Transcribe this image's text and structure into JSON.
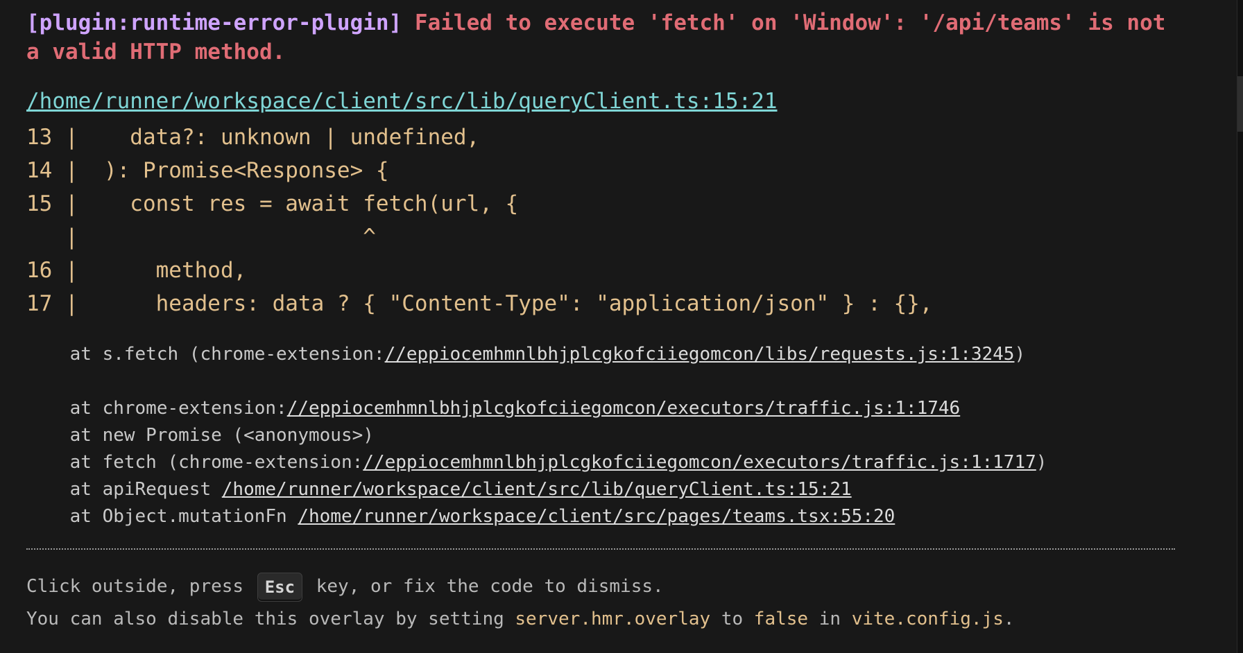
{
  "header": {
    "plugin": "[plugin:runtime-error-plugin]",
    "message": "Failed to execute 'fetch' on 'Window': '/api/teams' is not a valid HTTP method."
  },
  "file": "/home/runner/workspace/client/src/lib/queryClient.ts:15:21",
  "frame": [
    "13 |    data?: unknown | undefined,",
    "14 |  ): Promise<Response> {",
    "15 |    const res = await fetch(url, {",
    "   |                      ^",
    "16 |      method,",
    "17 |      headers: data ? { \"Content-Type\": \"application/json\" } : {},"
  ],
  "stack": {
    "l1_prefix": "    at s.fetch (chrome-extension:",
    "l1_link": "//eppiocemhmnlbhjplcgkofciiegomcon/libs/requests.js:1:3245",
    "l1_suffix": ")",
    "l2_prefix": "    at chrome-extension:",
    "l2_link": "//eppiocemhmnlbhjplcgkofciiegomcon/executors/traffic.js:1:1746",
    "l3": "    at new Promise (<anonymous>)",
    "l4_prefix": "    at fetch (chrome-extension:",
    "l4_link": "//eppiocemhmnlbhjplcgkofciiegomcon/executors/traffic.js:1:1717",
    "l4_suffix": ")",
    "l5_prefix": "    at apiRequest ",
    "l5_link": "/home/runner/workspace/client/src/lib/queryClient.ts:15:21",
    "l6_prefix": "    at Object.mutationFn ",
    "l6_link": "/home/runner/workspace/client/src/pages/teams.tsx:55:20"
  },
  "tip": {
    "line1_before": "Click outside, press ",
    "key": "Esc",
    "line1_after": " key, or fix the code to dismiss.",
    "line2_a": "You can also disable this overlay by setting ",
    "line2_code1": "server.hmr.overlay",
    "line2_b": " to ",
    "line2_code2": "false",
    "line2_c": " in ",
    "line2_code3": "vite.config.js",
    "line2_d": "."
  },
  "colors": {
    "background": "#181818",
    "plugin": "#cfa4ff",
    "error": "#e06c75",
    "link": "#7fd6d6",
    "code": "#e2c08d"
  }
}
